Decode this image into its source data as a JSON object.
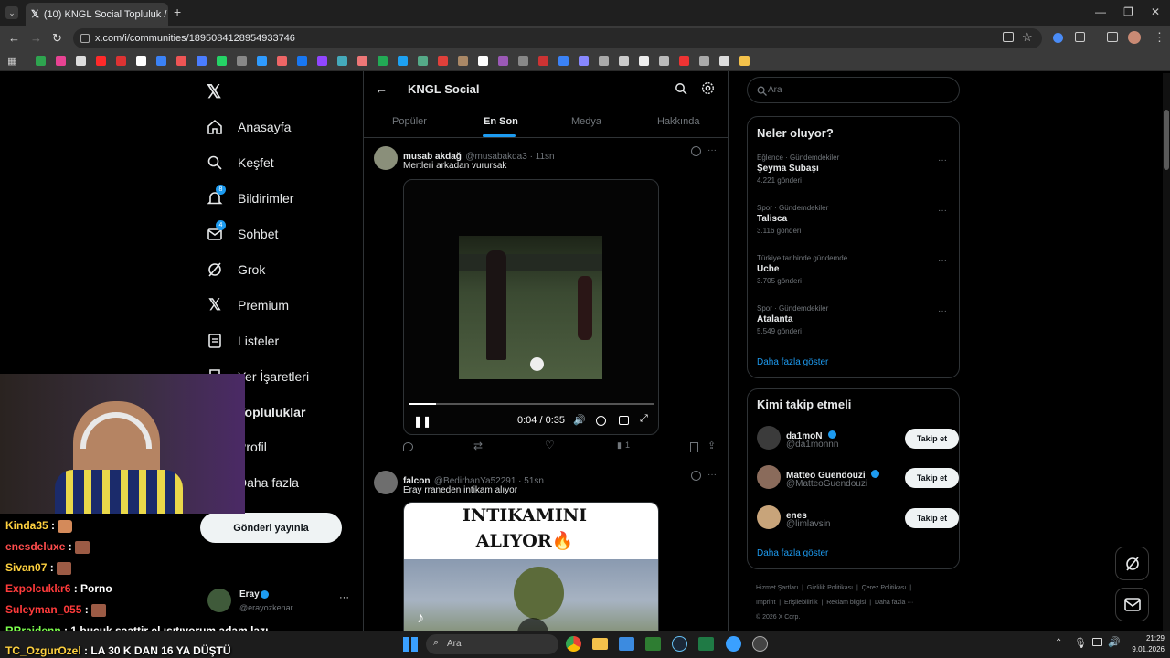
{
  "browser": {
    "tab_title": "(10) KNGL Social Topluluk /",
    "url": "x.com/i/communities/1895084128954933746"
  },
  "sidebar": {
    "items": [
      {
        "label": "Anasayfa",
        "icon": "home-icon"
      },
      {
        "label": "Keşfet",
        "icon": "search-icon"
      },
      {
        "label": "Bildirimler",
        "icon": "bell-icon",
        "badge": "8"
      },
      {
        "label": "Sohbet",
        "icon": "mail-icon",
        "badge": "4"
      },
      {
        "label": "Grok",
        "icon": "grok-icon"
      },
      {
        "label": "Premium",
        "icon": "x-icon"
      },
      {
        "label": "Listeler",
        "icon": "list-icon"
      },
      {
        "label": "Yer İşaretleri",
        "icon": "bookmark-icon"
      },
      {
        "label": "Topluluklar",
        "icon": "people-icon"
      },
      {
        "label": "Profil",
        "icon": "person-icon"
      },
      {
        "label": "Daha fazla",
        "icon": "more-icon"
      }
    ],
    "post_button": "Gönderi yayınla",
    "account": {
      "name": "Eray",
      "handle": "@erayozkenar"
    }
  },
  "header": {
    "title": "KNGL Social",
    "tabs": [
      "Popüler",
      "En Son",
      "Medya",
      "Hakkında"
    ],
    "active_tab": "En Son"
  },
  "posts": [
    {
      "name": "musab akdağ",
      "handle": "@musabakda3 · 11sn",
      "text": "Mertleri arkadan vurursak",
      "video_time": "0:04 / 0:35",
      "views": "1",
      "video_progress": 0.11
    },
    {
      "name": "falcon",
      "handle": "@BedirhanYa52291 · 51sn",
      "text": "Eray rraneden intikam alıyor",
      "overlay_line1": "INTIKAMINI",
      "overlay_line2": "ALIYOR🔥"
    }
  ],
  "right": {
    "search_placeholder": "Ara",
    "trends_title": "Neler oluyor?",
    "trends": [
      {
        "category": "Eğlence · Gündemdekiler",
        "name": "Şeyma Subaşı",
        "count": "4.221 gönderi"
      },
      {
        "category": "Spor · Gündemdekiler",
        "name": "Talisca",
        "count": "3.116 gönderi"
      },
      {
        "category": "Türkiye tarihinde gündemde",
        "name": "Uche",
        "count": "3.705 gönderi"
      },
      {
        "category": "Spor · Gündemdekiler",
        "name": "Atalanta",
        "count": "5.549 gönderi"
      }
    ],
    "show_more": "Daha fazla göster",
    "who_title": "Kimi takip etmeli",
    "who": [
      {
        "name": "da1moN",
        "handle": "@da1monnn",
        "verified": true
      },
      {
        "name": "Matteo Guendouzi",
        "handle": "@MatteoGuendouzi",
        "verified": true
      },
      {
        "name": "enes",
        "handle": "@limlavsin",
        "verified": false
      }
    ],
    "follow_label": "Takip et",
    "footer": {
      "line1": [
        "Hizmet Şartları",
        "Gizlilik Politikası",
        "Çerez Politikası"
      ],
      "line2": [
        "Imprint",
        "Erişilebilirlik",
        "Reklam bilgisi",
        "Daha fazla ···"
      ],
      "copyright": "© 2026 X Corp."
    }
  },
  "chat": [
    {
      "user": "Kinda35",
      "color": "#ffd23f",
      "msg": ""
    },
    {
      "user": "enesdeluxe",
      "color": "#ff4d4d",
      "msg": ""
    },
    {
      "user": "Sivan07",
      "color": "#ffd23f",
      "msg": ""
    },
    {
      "user": "Expolcukkr6",
      "color": "#ff3b3b",
      "msg": "Porno"
    },
    {
      "user": "Suleyman_055",
      "color": "#ff3b3b",
      "msg": ""
    },
    {
      "user": "RRraidenn",
      "color": "#7cff4d",
      "msg": "1 buçuk saattir el ısıtıyorum adam lazı"
    },
    {
      "user": "TC_OzgurOzel",
      "color": "#ffd23f",
      "msg": "LA 30 K DAN 16 YA DÜŞTÜ"
    }
  ],
  "taskbar": {
    "search": "Ara",
    "time": "21:29",
    "date": "9.01.2026"
  }
}
